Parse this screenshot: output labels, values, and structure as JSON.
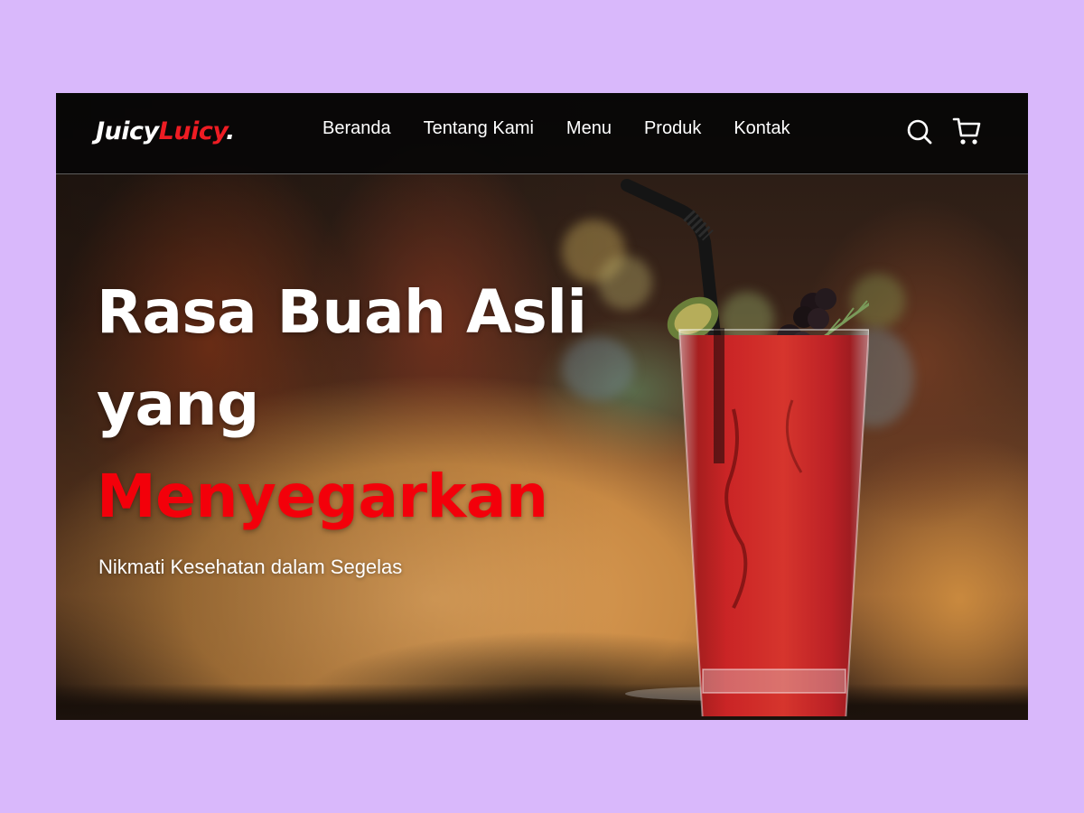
{
  "brand": {
    "part1": "Juicy",
    "part2": "Luicy",
    "dot": "."
  },
  "nav": {
    "items": [
      "Beranda",
      "Tentang Kami",
      "Menu",
      "Produk",
      "Kontak"
    ],
    "icons": [
      "search-icon",
      "cart-icon"
    ]
  },
  "hero": {
    "line1": "Rasa Buah Asli",
    "line2": "yang",
    "line3": "Menyegarkan",
    "subtitle": "Nikmati Kesehatan dalam Segelas"
  },
  "colors": {
    "accent": "#ee1c23",
    "page_background": "#d9b8fb",
    "navbar": "#080606"
  }
}
